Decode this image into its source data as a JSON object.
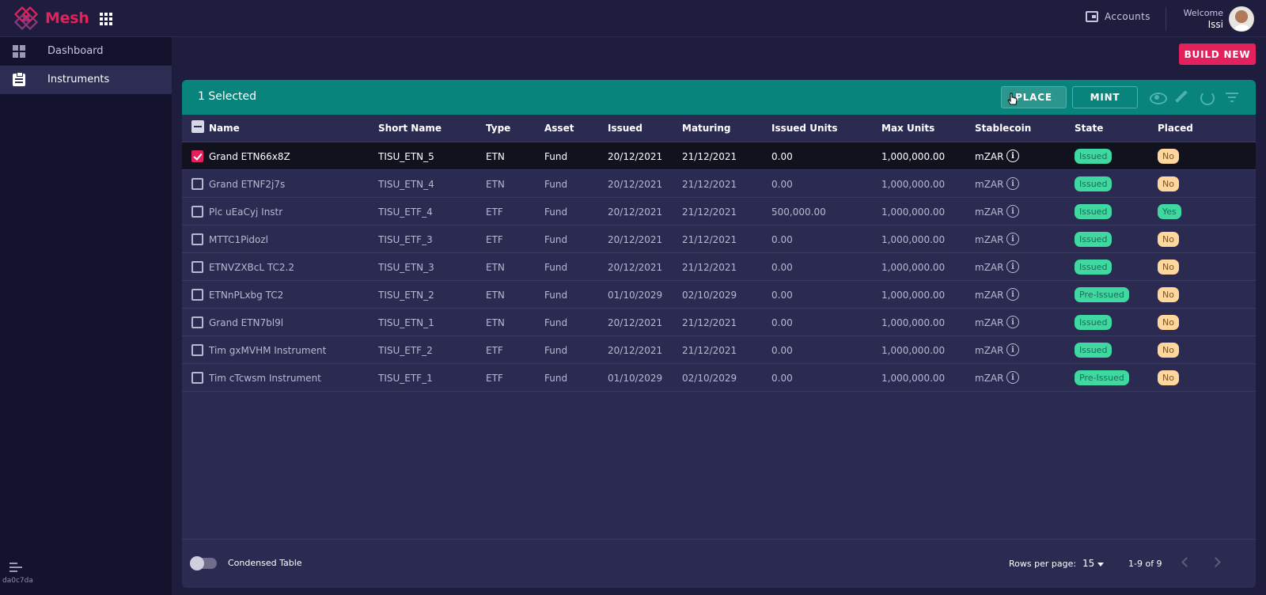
{
  "app": {
    "brand": "Mesh",
    "build_hash": "da0c7da"
  },
  "header": {
    "accounts_label": "Accounts",
    "welcome_label": "Welcome",
    "user_name": "Issi"
  },
  "sidebar": {
    "items": [
      {
        "label": "Dashboard",
        "icon": "dashboard-icon",
        "active": false
      },
      {
        "label": "Instruments",
        "icon": "clipboard-icon",
        "active": true
      }
    ]
  },
  "toolbar": {
    "build_new_label": "BUILD NEW"
  },
  "selection": {
    "text": "1 Selected",
    "place_label": "PLACE",
    "mint_label": "MINT"
  },
  "table": {
    "columns": [
      "Name",
      "Short Name",
      "Type",
      "Asset",
      "Issued",
      "Maturing",
      "Issued Units",
      "Max Units",
      "Stablecoin",
      "State",
      "Placed"
    ],
    "rows": [
      {
        "name": "Grand ETN66x8Z",
        "short": "TISU_ETN_5",
        "type": "ETN",
        "asset": "Fund",
        "issued": "20/12/2021",
        "maturing": "21/12/2021",
        "issued_units": "0.00",
        "max_units": "1,000,000.00",
        "stablecoin": "mZAR",
        "state": "Issued",
        "placed": "No",
        "selected": true
      },
      {
        "name": "Grand ETNF2j7s",
        "short": "TISU_ETN_4",
        "type": "ETN",
        "asset": "Fund",
        "issued": "20/12/2021",
        "maturing": "21/12/2021",
        "issued_units": "0.00",
        "max_units": "1,000,000.00",
        "stablecoin": "mZAR",
        "state": "Issued",
        "placed": "No",
        "selected": false
      },
      {
        "name": "Plc uEaCyj Instr",
        "short": "TISU_ETF_4",
        "type": "ETF",
        "asset": "Fund",
        "issued": "20/12/2021",
        "maturing": "21/12/2021",
        "issued_units": "500,000.00",
        "max_units": "1,000,000.00",
        "stablecoin": "mZAR",
        "state": "Issued",
        "placed": "Yes",
        "selected": false
      },
      {
        "name": "MTTC1Pidozl",
        "short": "TISU_ETF_3",
        "type": "ETF",
        "asset": "Fund",
        "issued": "20/12/2021",
        "maturing": "21/12/2021",
        "issued_units": "0.00",
        "max_units": "1,000,000.00",
        "stablecoin": "mZAR",
        "state": "Issued",
        "placed": "No",
        "selected": false
      },
      {
        "name": "ETNVZXBcL TC2.2",
        "short": "TISU_ETN_3",
        "type": "ETN",
        "asset": "Fund",
        "issued": "20/12/2021",
        "maturing": "21/12/2021",
        "issued_units": "0.00",
        "max_units": "1,000,000.00",
        "stablecoin": "mZAR",
        "state": "Issued",
        "placed": "No",
        "selected": false
      },
      {
        "name": "ETNnPLxbg TC2",
        "short": "TISU_ETN_2",
        "type": "ETN",
        "asset": "Fund",
        "issued": "01/10/2029",
        "maturing": "02/10/2029",
        "issued_units": "0.00",
        "max_units": "1,000,000.00",
        "stablecoin": "mZAR",
        "state": "Pre-Issued",
        "placed": "No",
        "selected": false
      },
      {
        "name": "Grand ETN7bl9l",
        "short": "TISU_ETN_1",
        "type": "ETN",
        "asset": "Fund",
        "issued": "20/12/2021",
        "maturing": "21/12/2021",
        "issued_units": "0.00",
        "max_units": "1,000,000.00",
        "stablecoin": "mZAR",
        "state": "Issued",
        "placed": "No",
        "selected": false
      },
      {
        "name": "Tim gxMVHM Instrument",
        "short": "TISU_ETF_2",
        "type": "ETF",
        "asset": "Fund",
        "issued": "20/12/2021",
        "maturing": "21/12/2021",
        "issued_units": "0.00",
        "max_units": "1,000,000.00",
        "stablecoin": "mZAR",
        "state": "Issued",
        "placed": "No",
        "selected": false
      },
      {
        "name": "Tim cTcwsm Instrument",
        "short": "TISU_ETF_1",
        "type": "ETF",
        "asset": "Fund",
        "issued": "01/10/2029",
        "maturing": "02/10/2029",
        "issued_units": "0.00",
        "max_units": "1,000,000.00",
        "stablecoin": "mZAR",
        "state": "Pre-Issued",
        "placed": "No",
        "selected": false
      }
    ]
  },
  "footer": {
    "condensed_label": "Condensed Table",
    "rows_per_page_label": "Rows per page:",
    "rows_per_page": "15",
    "range": "1-9 of 9"
  },
  "colors": {
    "accent": "#e2215d",
    "teal": "#08847c",
    "state_green": "#3fd8a0",
    "placed_no": "#ffd79c"
  }
}
